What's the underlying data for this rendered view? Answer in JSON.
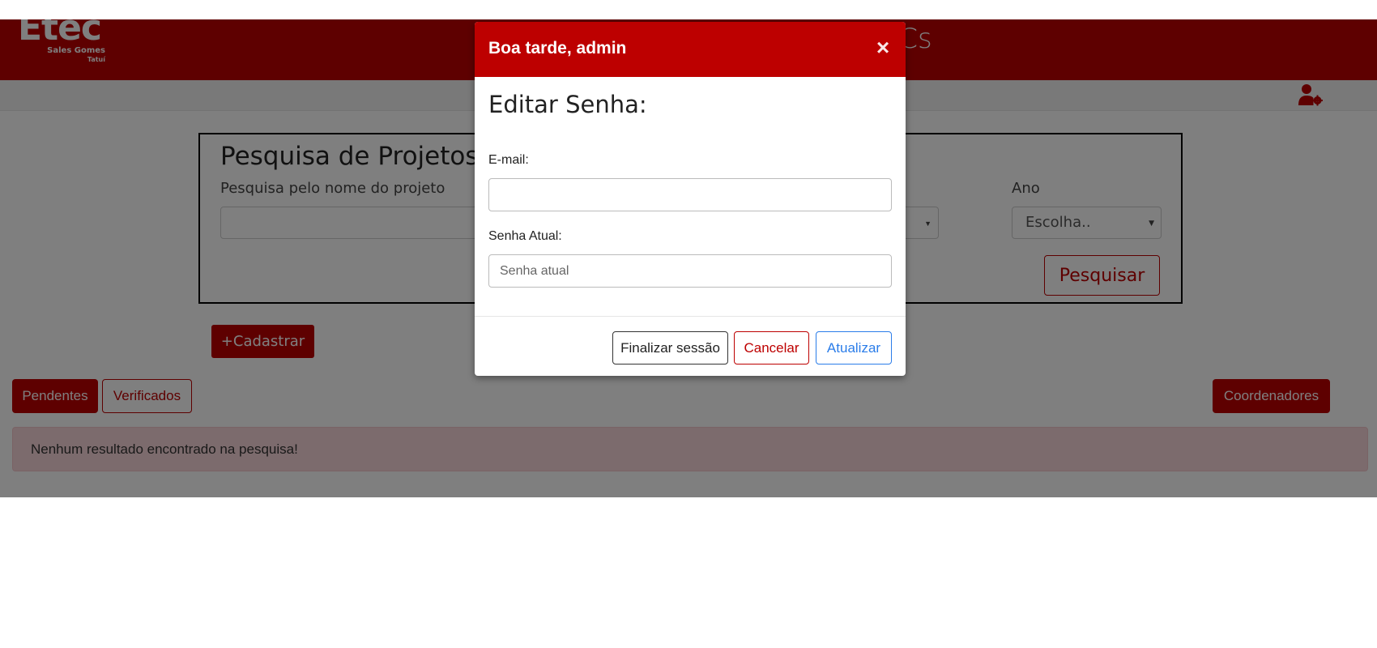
{
  "header": {
    "logo_main": "Etec",
    "logo_sub1": "Sales Gomes",
    "logo_sub2": "Tatuí",
    "title": "Cs"
  },
  "search": {
    "title": "Pesquisa de Projetos",
    "name_label": "Pesquisa pelo nome do projeto",
    "year_label": "Ano",
    "year_value": "Escolha..",
    "submit_label": "Pesquisar"
  },
  "actions": {
    "cadastrar_label": "+Cadastrar",
    "pendentes_label": "Pendentes",
    "verificados_label": "Verificados",
    "coordenadores_label": "Coordenadores"
  },
  "alert": {
    "message": "Nenhum resultado encontrado na pesquisa!"
  },
  "modal": {
    "title": "Boa tarde, admin",
    "close_glyph": "×",
    "subtitle": "Editar Senha:",
    "email_label": "E-mail:",
    "email_value": "",
    "current_password_label": "Senha Atual:",
    "current_password_placeholder": "Senha atual",
    "finalizar_label": "Finalizar sessão",
    "cancelar_label": "Cancelar",
    "atualizar_label": "Atualizar"
  },
  "colors": {
    "brand_red": "#bd0000",
    "link_blue": "#2b7de9",
    "alert_bg": "#f8d7da"
  },
  "icons": {
    "user_settings": "user-cog-icon",
    "close": "close-icon",
    "caret": "caret-down-icon"
  }
}
